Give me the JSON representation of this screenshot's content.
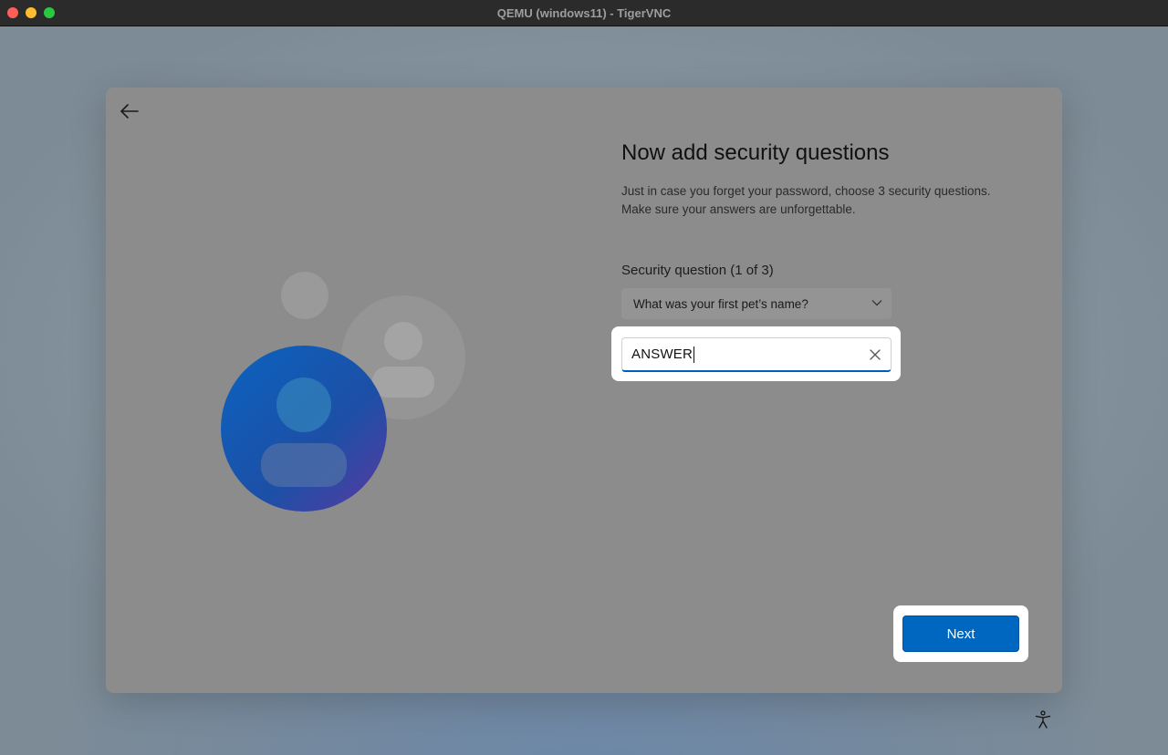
{
  "window": {
    "title": "QEMU (windows11) - TigerVNC"
  },
  "page": {
    "heading": "Now add security questions",
    "description": "Just in case you forget your password, choose 3 security questions. Make sure your answers are unforgettable."
  },
  "question": {
    "label": "Security question (1 of 3)",
    "selected": "What was your first pet’s name?"
  },
  "answer": {
    "value": "ANSWER"
  },
  "buttons": {
    "next": "Next"
  },
  "icons": {
    "back": "back-arrow-icon",
    "clear": "close-icon",
    "dropdown": "chevron-down-icon",
    "accessibility": "accessibility-icon"
  },
  "colors": {
    "accent": "#0067c0",
    "overlay": "#8c8c8c"
  }
}
